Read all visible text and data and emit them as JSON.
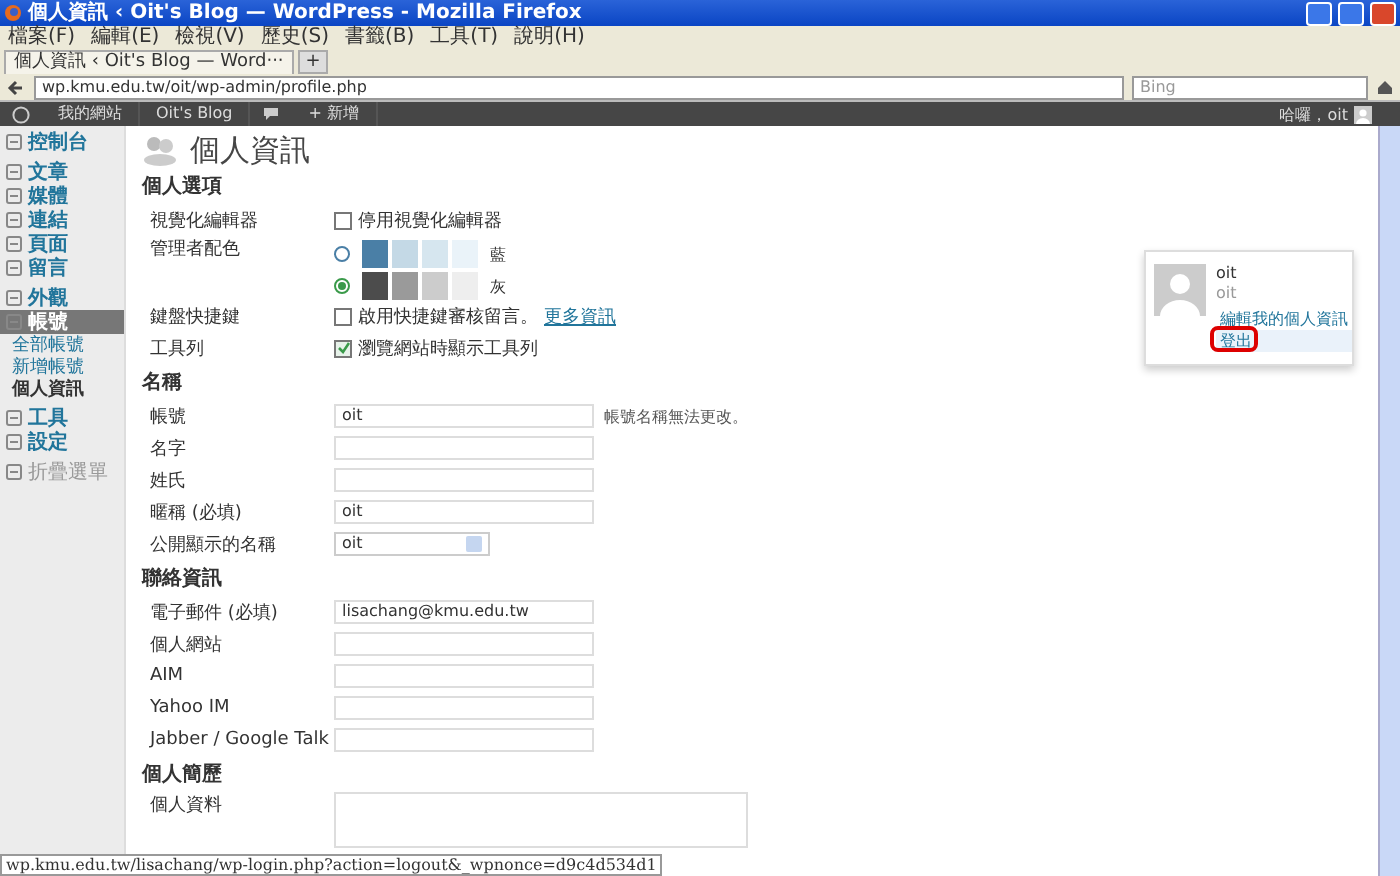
{
  "window": {
    "title": "個人資訊 ‹ Oit's Blog — WordPress - Mozilla Firefox"
  },
  "menu_bar": [
    "檔案(F)",
    "編輯(E)",
    "檢視(V)",
    "歷史(S)",
    "書籤(B)",
    "工具(T)",
    "說明(H)"
  ],
  "tabs": [
    {
      "label": "個人資訊 ‹ Oit's Blog — Word···",
      "selected": true
    }
  ],
  "new_tab": "+",
  "address_bar": {
    "url": "wp.kmu.edu.tw/oit/wp-admin/profile.php"
  },
  "search": {
    "placeholder": "Bing"
  },
  "admin_bar": {
    "items": [
      "我的網站",
      "Oit's Blog",
      "+ 新增"
    ],
    "greeting": "哈囉，oit"
  },
  "sidebar": {
    "items": [
      {
        "label": "控制台",
        "selected": false
      },
      {
        "label": "文章",
        "selected": false
      },
      {
        "label": "媒體",
        "selected": false
      },
      {
        "label": "連結",
        "selected": false
      },
      {
        "label": "頁面",
        "selected": false
      },
      {
        "label": "留言",
        "selected": false
      },
      {
        "label": "外觀",
        "selected": false
      },
      {
        "label": "帳號",
        "selected": true,
        "children": [
          {
            "label": "全部帳號",
            "selected": false
          },
          {
            "label": "新增帳號",
            "selected": false
          },
          {
            "label": "個人資訊",
            "selected": true
          }
        ]
      },
      {
        "label": "工具",
        "selected": false
      },
      {
        "label": "設定",
        "selected": false
      }
    ],
    "collapse": "折疊選單"
  },
  "page": {
    "title": "個人資訊",
    "sections": [
      {
        "heading": "個人選項",
        "rows": [
          {
            "kind": "checkbox",
            "label": "視覺化編輯器",
            "text": "停用視覺化編輯器",
            "checked": false
          },
          {
            "kind": "colors",
            "label": "管理者配色",
            "schemes": [
              {
                "name": "藍",
                "selected": false,
                "swatches": [
                  {
                    "color": "#4a7fa6"
                  },
                  {
                    "color": "#c4d9e6"
                  },
                  {
                    "color": "#d6e6ef"
                  },
                  {
                    "color": "#eaf3f9"
                  }
                ]
              },
              {
                "name": "灰",
                "selected": true,
                "swatches": [
                  {
                    "color": "#4c4c4c"
                  },
                  {
                    "color": "#9a9a9a"
                  },
                  {
                    "color": "#cccccc"
                  },
                  {
                    "color": "#eeeeee"
                  }
                ]
              }
            ]
          },
          {
            "kind": "checkbox",
            "label": "鍵盤快捷鍵",
            "text": "啟用快捷鍵審核留言。",
            "link": "更多資訊",
            "checked": false
          },
          {
            "kind": "checkbox",
            "label": "工具列",
            "text": "瀏覽網站時顯示工具列",
            "checked": true
          }
        ]
      },
      {
        "heading": "名稱",
        "rows": [
          {
            "kind": "input",
            "label": "帳號",
            "value": "oit",
            "note": "帳號名稱無法更改。"
          },
          {
            "kind": "input",
            "label": "名字"
          },
          {
            "kind": "input",
            "label": "姓氏"
          },
          {
            "kind": "input",
            "label": "暱稱 (必填)",
            "value": "oit"
          },
          {
            "kind": "select",
            "label": "公開顯示的名稱",
            "value": "oit"
          }
        ]
      },
      {
        "heading": "聯絡資訊",
        "rows": [
          {
            "kind": "input",
            "label": "電子郵件 (必填)",
            "value": "lisachang@kmu.edu.tw"
          },
          {
            "kind": "input",
            "label": "個人網站"
          },
          {
            "kind": "input",
            "label": "AIM"
          },
          {
            "kind": "input",
            "label": "Yahoo IM"
          },
          {
            "kind": "input",
            "label": "Jabber / Google Talk"
          }
        ]
      },
      {
        "heading": "個人簡歷",
        "rows": [
          {
            "kind": "textarea",
            "label": "個人資料"
          }
        ]
      }
    ]
  },
  "user_menu": {
    "name": "oit",
    "username": "oit",
    "items": [
      {
        "label": "編輯我的個人資訊",
        "selected": false,
        "circled": false
      },
      {
        "label": "登出",
        "selected": true,
        "circled": true
      }
    ]
  },
  "status_bar": {
    "text": "wp.kmu.edu.tw/lisachang/wp-login.php?action=logout&_wpnonce=d9c4d534d1"
  }
}
